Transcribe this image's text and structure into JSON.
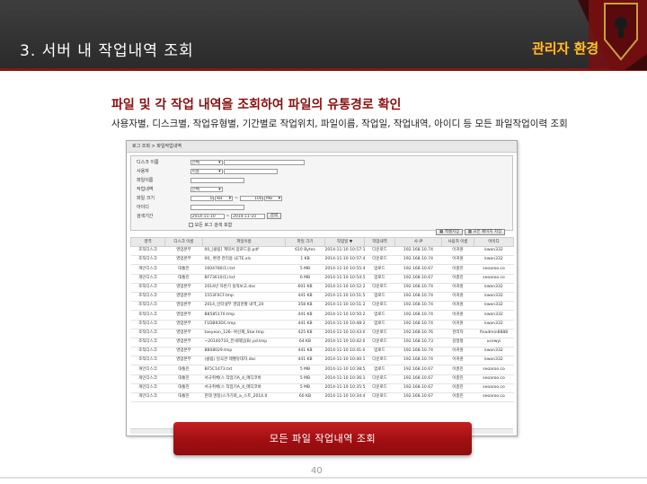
{
  "header": {
    "title": "3. 서버 내 작업내역 조회",
    "logo_text": "관리자 환경"
  },
  "subhead": "파일 및 각 작업 내역을 조회하여 파일의 유통경로 확인",
  "description": "사용자별, 디스크별, 작업유형별, 기간별로  작업위치, 파일이름, 작업일, 작업내역, 아이디 등 모든 파일작업이력 조회",
  "panel": {
    "tab_label": "로그 조회 > 파일작업내역",
    "search": {
      "disk_label": "디스크 이름",
      "disk_value": "전체",
      "user_label": "사용자",
      "user_value": "이름",
      "file_label": "파일이름",
      "work_label": "작업내역",
      "work_value": "전체",
      "size_label": "파일 크기",
      "size_from": "0",
      "size_from_unit": "KB",
      "size_to": "100",
      "size_to_unit": "MB",
      "id_label": "아이디",
      "period_label": "검색기간",
      "date_from": "2014-11-10",
      "date_to": "2014-11-10",
      "search_button": "검색",
      "option_label": "모든 로그 검색 포함"
    },
    "export_buttons": [
      "엑셀저장",
      "모든 페이지 저장"
    ],
    "columns": [
      "영역",
      "디스크 이름",
      "파일이름",
      "파일 크기",
      "작업일 ▼",
      "작업내역",
      "사 IP",
      "사용자 이름",
      "아이디"
    ],
    "rows": [
      [
        "조직디스크",
        "영업본부",
        "00_[클립] 계약서 업로드용.pdf",
        "610 Bytes",
        "2014-11-10 10:57:11",
        "다운로드",
        "192.168.10.74",
        "이귀원",
        "kwon332"
      ],
      [
        "조직디스크",
        "영업본부",
        "00_ 환경 관리용 LETE.xls",
        "1 KB",
        "2014-11-10 10:57:47",
        "다운로드",
        "192.168.10.74",
        "이귀원",
        "kwon332"
      ],
      [
        "개인디스크",
        "대통진",
        "1604780(1).txt",
        "5 MB",
        "2014-11-10 10:55:41",
        "업로드",
        "192.168.10.67",
        "이충진",
        "seoaroo.co"
      ],
      [
        "개인디스크",
        "대통진",
        "BF73610(1).txt",
        "6 MB",
        "2014-11-10 10:54:51",
        "업로드",
        "192.168.10.67",
        "이충진",
        "seoaroo.co"
      ],
      [
        "조직디스크",
        "영업본부",
        "2014년 하반기 실적보고.doc",
        "601 KB",
        "2014-11-10 10:52:21",
        "다운로드",
        "192.168.10.74",
        "이귀원",
        "kwon332"
      ],
      [
        "조직디스크",
        "영업본부",
        "1553F0CF.tmp",
        "441 KB",
        "2014-11-10 10:51:57",
        "업로드",
        "192.168.10.74",
        "이귀원",
        "kwon332"
      ],
      [
        "조직디스크",
        "영업본부",
        "2014_인터넷부 영업현황 내역_20",
        "358 KB",
        "2014-11-10 10:51:28",
        "다운로드",
        "192.168.10.74",
        "이귀원",
        "kwon332"
      ],
      [
        "조직디스크",
        "영업본부",
        "B8585170.tmp",
        "441 KB",
        "2014-11-10 10:50:23",
        "업로드",
        "192.168.10.74",
        "이귀원",
        "kwon332"
      ],
      [
        "조직디스크",
        "영업본부",
        "F1DB93DC.tmp",
        "441 KB",
        "2014-11-10 10:48:20",
        "업로드",
        "192.168.10.74",
        "이귀원",
        "kwon332"
      ],
      [
        "조직디스크",
        "영업본부",
        "taeyeon_126--위선재_Star.tmp",
        "425 KB",
        "2014-11-10 10:43:06",
        "다운로드",
        "192.168.10.76",
        "관리자",
        "finadmin8888"
      ],
      [
        "조직디스크",
        "영업본부",
        "~20140710_전세재임(B) pd.tmp",
        "64 KB",
        "2014-11-10 10:42:01",
        "다운로드",
        "192.168.10.73",
        "김정철",
        "ucewyi"
      ],
      [
        "조직디스크",
        "영업본부",
        "8B08029.tmp",
        "441 KB",
        "2014-11-10 10:41:06",
        "업로드",
        "192.168.10.74",
        "이귀원",
        "kwon332"
      ],
      [
        "조직디스크",
        "영업본부",
        "(클립) 일곡관 레벨유대자.doc",
        "441 KB",
        "2014-11-10 10:40:11",
        "다운로드",
        "192.168.10.74",
        "이귀원",
        "kwon332"
      ],
      [
        "개인디스크",
        "대통진",
        "BF5C1473.txt",
        "5 MB",
        "2014-11-10 10:38:56",
        "업로드",
        "192.168.10.67",
        "이충진",
        "seoaroo.co"
      ],
      [
        "개인디스크",
        "대통진",
        "서규취체(스 작업기A_4_메디코바",
        "5 MB",
        "2014-11-10 10:36:14",
        "다운로드",
        "192.168.10.67",
        "이충진",
        "seoaroo.co"
      ],
      [
        "개인디스크",
        "대통진",
        "서규취체(스 작업기A_4_메디코바",
        "5 MB",
        "2014-11-10 10:35:51",
        "다운로드",
        "192.168.10.67",
        "이충진",
        "seoaroo.co"
      ],
      [
        "개인디스크",
        "대통진",
        "한데 명칭(스가기회_a_스트_2014.0",
        "60 KB",
        "2014-11-10 10:34:49",
        "다운로드",
        "192.168.10.67",
        "이충진",
        "seoaroo.co"
      ]
    ]
  },
  "action_button": "모든 파일 작업내역 조회",
  "page_number": "40",
  "colors": {
    "header_bg": "#2f2f2f",
    "accent_red": "#a10f12",
    "subhead_red": "#8a1010",
    "logo_gold": "#f4c23a"
  }
}
